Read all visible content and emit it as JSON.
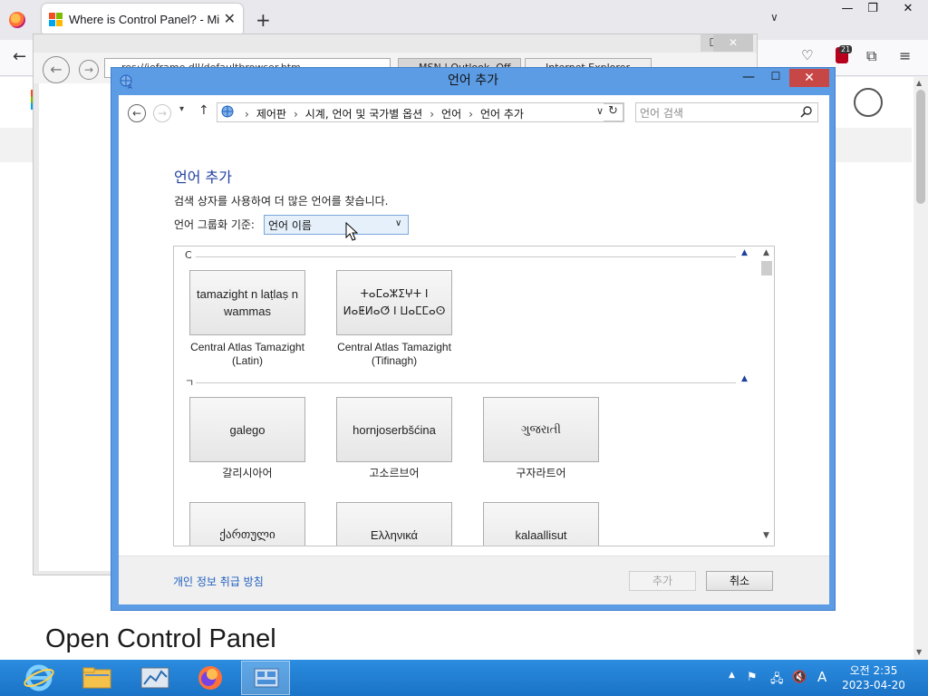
{
  "browser": {
    "tab_title": "Where is Control Panel? - Micr",
    "new_tab_icon": "plus-icon",
    "extension_badge_count": "21"
  },
  "ie_window": {
    "address": "res://ieframe.dll/defaultbrowser.htm",
    "tabs": [
      "MSN | Outlook, Off",
      "Internet Explorer"
    ]
  },
  "page": {
    "heading": "Open Control Panel"
  },
  "dialog": {
    "title": "언어 추가",
    "breadcrumbs": [
      "제어판",
      "시계, 언어 및 국가별 옵션",
      "언어",
      "언어 추가"
    ],
    "search_placeholder": "언어 검색",
    "heading": "언어 추가",
    "description": "검색 상자를 사용하여 더 많은 언어를 찾습니다.",
    "group_label": "언어 그룹화 기준:",
    "group_value": "언어 이름",
    "sections": [
      {
        "letter": "C",
        "tiles": [
          {
            "native": "tamazight n laṭlaṣ n wammas",
            "name": "Central Atlas Tamazight (Latin)"
          },
          {
            "native": "ⵜⴰⵎⴰⵣⵉⵖⵜ ⵏ ⵍⴰⵟⵍⴰⵚ ⵏ ⵡⴰⵎⵎⴰⵙ",
            "name": "Central Atlas Tamazight (Tifinagh)"
          }
        ]
      },
      {
        "letter": "ㄱ",
        "tiles": [
          {
            "native": "galego",
            "name": "갈리시아어"
          },
          {
            "native": "hornjoserbšćina",
            "name": "고소르브어"
          },
          {
            "native": "ગુજરાતી",
            "name": "구자라트어"
          },
          {
            "native": "ქართული",
            "name": ""
          },
          {
            "native": "Ελληνικά",
            "name": ""
          },
          {
            "native": "kalaallisut",
            "name": ""
          }
        ]
      }
    ],
    "privacy_link": "개인 정보 취급 방침",
    "add_button": "추가",
    "cancel_button": "취소"
  },
  "taskbar": {
    "time": "오전 2:35",
    "date": "2023-04-20",
    "ime_indicator": "A"
  },
  "colors": {
    "dialog_border": "#5c9ce4",
    "heading_blue": "#1f3f9f",
    "taskbar": "#1d7fd6",
    "close_red": "#c74646"
  }
}
